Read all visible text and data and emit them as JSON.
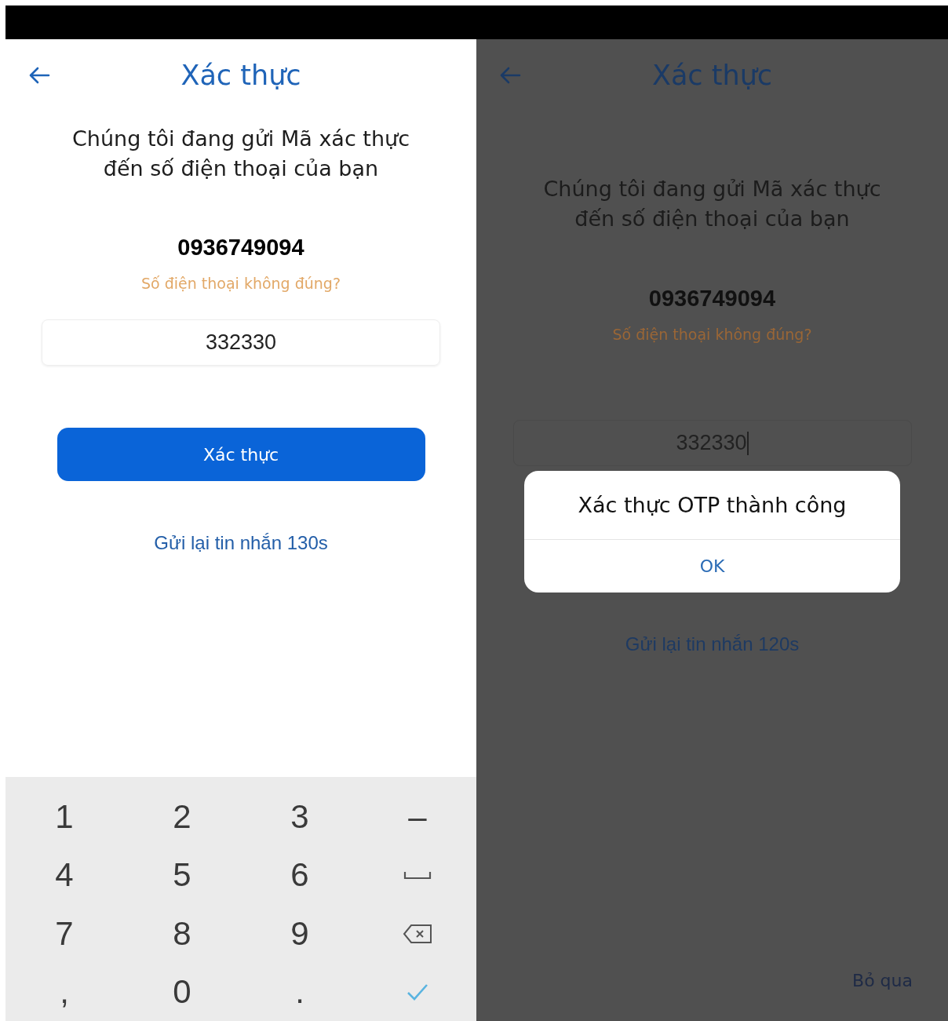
{
  "screens": [
    {
      "dimmed": false,
      "header": {
        "title": "Xác thực"
      },
      "message": "Chúng tôi đang gửi Mã xác thực\nđến số điện thoại của bạn",
      "phone": "0936749094",
      "wrong_number_link": "Số điện thoại không đúng?",
      "otp_field": {
        "value": "332330",
        "focused": false
      },
      "submit_button": "Xác thực",
      "resend_link": "Gửi lại tin nhắn 130s",
      "keypad": [
        {
          "kind": "char",
          "label": "1"
        },
        {
          "kind": "char",
          "label": "2"
        },
        {
          "kind": "char",
          "label": "3"
        },
        {
          "kind": "char",
          "label": "–"
        },
        {
          "kind": "char",
          "label": "4"
        },
        {
          "kind": "char",
          "label": "5"
        },
        {
          "kind": "char",
          "label": "6"
        },
        {
          "kind": "space"
        },
        {
          "kind": "char",
          "label": "7"
        },
        {
          "kind": "char",
          "label": "8"
        },
        {
          "kind": "char",
          "label": "9"
        },
        {
          "kind": "backspace"
        },
        {
          "kind": "char",
          "label": ","
        },
        {
          "kind": "char",
          "label": "0"
        },
        {
          "kind": "char",
          "label": "."
        },
        {
          "kind": "done"
        }
      ]
    },
    {
      "dimmed": true,
      "header": {
        "title": "Xác thực"
      },
      "message": "Chúng tôi đang gửi Mã xác thực\nđến số điện thoại của bạn",
      "phone": "0936749094",
      "wrong_number_link": "Số điện thoại không đúng?",
      "otp_field": {
        "value": "332330",
        "focused": true
      },
      "dialog": {
        "message": "Xác thực OTP thành công",
        "button": "OK"
      },
      "resend_link": "Gửi lại tin nhắn 120s",
      "skip_link": "Bỏ qua"
    }
  ]
}
